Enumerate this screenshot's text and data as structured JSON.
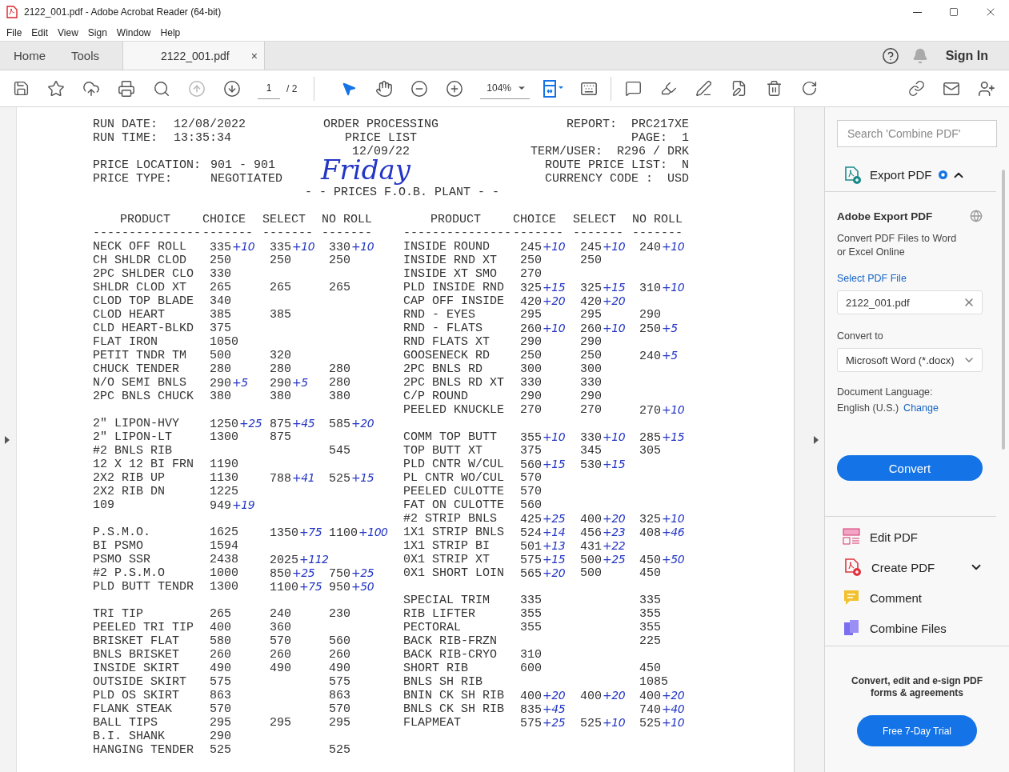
{
  "window": {
    "title": "2122_001.pdf - Adobe Acrobat Reader (64-bit)"
  },
  "menu": [
    "File",
    "Edit",
    "View",
    "Sign",
    "Window",
    "Help"
  ],
  "tabs": [
    {
      "kind": "nav",
      "label": "Home",
      "selected": false
    },
    {
      "kind": "nav",
      "label": "Tools",
      "selected": false
    },
    {
      "kind": "document",
      "label": "2122_001.pdf",
      "close": "×",
      "selected": true
    }
  ],
  "sign_in": "Sign In",
  "toolbar": {
    "previous_page": {
      "disabled": true
    },
    "next_page": {
      "disabled": false
    },
    "page": "1",
    "page_total": "/ 2",
    "tools": [
      {
        "selected": true
      },
      {
        "selected": false
      }
    ],
    "zoom": "104%"
  },
  "document": {
    "header_left": [
      [
        {
          "label": "RUN DATE:",
          "value": "12/08/2022"
        },
        {
          "label": "RUN TIME:",
          "value": "13:35:34"
        }
      ],
      [
        {
          "label": "PRICE LOCATION:",
          "value": "901 - 901"
        },
        {
          "label": "PRICE TYPE:",
          "value": "NEGOTIATED"
        }
      ]
    ],
    "header_center": [
      "ORDER PROCESSING",
      "PRICE LIST",
      "12/09/22"
    ],
    "handwriting": "Friday",
    "subtitle": "- - PRICES F.O.B. PLANT - -",
    "header_right": [
      {
        "label": "REPORT:",
        "value": "PRC217XE"
      },
      {
        "label": "PAGE:",
        "value": "1"
      },
      {
        "label": "TERM/USER:",
        "value": "R296 / DRK"
      },
      {
        "label": "ROUTE PRICE LIST:",
        "value": "N"
      },
      {
        "label": "CURRENCY CODE :",
        "value": "USD"
      }
    ],
    "tables": [
      {
        "columns": [
          "PRODUCT",
          "CHOICE",
          "SELECT",
          "NO ROLL"
        ],
        "rules": [
          "---------------",
          "-------",
          "-------",
          "-------"
        ],
        "groups": [
          [
            {
              "product": "NECK OFF ROLL",
              "choice": {
                "price": "335",
                "note": "+10"
              },
              "select": {
                "price": "335",
                "note": "+10"
              },
              "no_roll": {
                "price": "330",
                "note": "+10"
              }
            },
            {
              "product": "CH SHLDR CLOD",
              "choice": {
                "price": "250"
              },
              "select": {
                "price": "250"
              },
              "no_roll": {
                "price": "250"
              }
            },
            {
              "product": "2PC SHLDER CLO",
              "choice": {
                "price": "330"
              }
            },
            {
              "product": "SHLDR CLOD XT",
              "choice": {
                "price": "265"
              },
              "select": {
                "price": "265"
              },
              "no_roll": {
                "price": "265"
              }
            },
            {
              "product": "CLOD TOP BLADE",
              "choice": {
                "price": "340"
              }
            },
            {
              "product": "CLOD HEART",
              "choice": {
                "price": "385"
              },
              "select": {
                "price": "385"
              }
            },
            {
              "product": "CLD HEART-BLKD",
              "choice": {
                "price": "375"
              }
            },
            {
              "product": "FLAT IRON",
              "choice": {
                "price": "1050"
              }
            },
            {
              "product": "PETIT TNDR TM",
              "choice": {
                "price": "500"
              },
              "select": {
                "price": "320"
              }
            },
            {
              "product": "CHUCK TENDER",
              "choice": {
                "price": "280"
              },
              "select": {
                "price": "280"
              },
              "no_roll": {
                "price": "280"
              }
            },
            {
              "product": "N/O SEMI BNLS",
              "choice": {
                "price": "290",
                "note": "+5"
              },
              "select": {
                "price": "290",
                "note": "+5"
              },
              "no_roll": {
                "price": "280"
              }
            },
            {
              "product": "2PC BNLS CHUCK",
              "choice": {
                "price": "380"
              },
              "select": {
                "price": "380"
              },
              "no_roll": {
                "price": "380"
              }
            }
          ],
          [
            {
              "product": "2\" LIPON-HVY",
              "choice": {
                "price": "1250",
                "note": "+25"
              },
              "select": {
                "price": "875",
                "note": "+45"
              },
              "no_roll": {
                "price": "585",
                "note": "+20"
              }
            },
            {
              "product": "2\" LIPON-LT",
              "choice": {
                "price": "1300"
              },
              "select": {
                "price": "875"
              }
            },
            {
              "product": "#2 BNLS RIB",
              "no_roll": {
                "price": "545"
              }
            },
            {
              "product": "12 X 12 BI FRN",
              "choice": {
                "price": "1190"
              }
            },
            {
              "product": "2X2 RIB UP",
              "choice": {
                "price": "1130"
              },
              "select": {
                "price": "788",
                "note": "+41"
              },
              "no_roll": {
                "price": "525",
                "note": "+15"
              }
            },
            {
              "product": "2X2 RIB DN",
              "choice": {
                "price": "1225"
              }
            },
            {
              "product": "109",
              "choice": {
                "price": "949",
                "note": "+19"
              }
            }
          ],
          [
            {
              "product": "P.S.M.O.",
              "choice": {
                "price": "1625"
              },
              "select": {
                "price": "1350",
                "note": "+75"
              },
              "no_roll": {
                "price": "1100",
                "note": "+100"
              }
            },
            {
              "product": "BI PSMO",
              "choice": {
                "price": "1594"
              }
            },
            {
              "product": "PSMO SSR",
              "choice": {
                "price": "2438"
              },
              "select": {
                "price": "2025",
                "note": "+112"
              }
            },
            {
              "product": "#2 P.S.M.O",
              "choice": {
                "price": "1000"
              },
              "select": {
                "price": "850",
                "note": "+25"
              },
              "no_roll": {
                "price": "750",
                "note": "+25"
              }
            },
            {
              "product": "PLD BUTT TENDR",
              "choice": {
                "price": "1300"
              },
              "select": {
                "price": "1100",
                "note": "+75"
              },
              "no_roll": {
                "price": "950",
                "note": "+50"
              }
            }
          ],
          [
            {
              "product": "TRI TIP",
              "choice": {
                "price": "265"
              },
              "select": {
                "price": "240"
              },
              "no_roll": {
                "price": "230"
              }
            },
            {
              "product": "PEELED TRI TIP",
              "choice": {
                "price": "400"
              },
              "select": {
                "price": "360"
              }
            },
            {
              "product": "BRISKET FLAT",
              "choice": {
                "price": "580"
              },
              "select": {
                "price": "570"
              },
              "no_roll": {
                "price": "560"
              }
            },
            {
              "product": "BNLS BRISKET",
              "choice": {
                "price": "260"
              },
              "select": {
                "price": "260"
              },
              "no_roll": {
                "price": "260"
              }
            },
            {
              "product": "INSIDE SKIRT",
              "choice": {
                "price": "490"
              },
              "select": {
                "price": "490"
              },
              "no_roll": {
                "price": "490"
              }
            },
            {
              "product": "OUTSIDE SKIRT",
              "choice": {
                "price": "575"
              },
              "no_roll": {
                "price": "575"
              }
            },
            {
              "product": "PLD OS SKIRT",
              "choice": {
                "price": "863"
              },
              "no_roll": {
                "price": "863"
              }
            },
            {
              "product": "FLANK STEAK",
              "choice": {
                "price": "570"
              },
              "no_roll": {
                "price": "570"
              }
            },
            {
              "product": "BALL TIPS",
              "choice": {
                "price": "295"
              },
              "select": {
                "price": "295"
              },
              "no_roll": {
                "price": "295"
              }
            },
            {
              "product": "B.I. SHANK",
              "choice": {
                "price": "290"
              }
            },
            {
              "product": "HANGING TENDER",
              "choice": {
                "price": "525"
              },
              "no_roll": {
                "price": "525"
              }
            }
          ]
        ]
      },
      {
        "columns": [
          "PRODUCT",
          "CHOICE",
          "SELECT",
          "NO ROLL"
        ],
        "rules": [
          "---------------",
          "-------",
          "-------",
          "-------"
        ],
        "groups": [
          [
            {
              "product": "INSIDE ROUND",
              "choice": {
                "price": "245",
                "note": "+10"
              },
              "select": {
                "price": "245",
                "note": "+10"
              },
              "no_roll": {
                "price": "240",
                "note": "+10"
              }
            },
            {
              "product": "INSIDE RND XT",
              "choice": {
                "price": "250"
              },
              "select": {
                "price": "250"
              }
            },
            {
              "product": "INSIDE XT SMO",
              "choice": {
                "price": "270"
              }
            },
            {
              "product": "PLD INSIDE RND",
              "choice": {
                "price": "325",
                "note": "+15"
              },
              "select": {
                "price": "325",
                "note": "+15"
              },
              "no_roll": {
                "price": "310",
                "note": "+10"
              }
            },
            {
              "product": "CAP OFF INSIDE",
              "choice": {
                "price": "420",
                "note": "+20"
              },
              "select": {
                "price": "420",
                "note": "+20"
              }
            },
            {
              "product": "RND - EYES",
              "choice": {
                "price": "295"
              },
              "select": {
                "price": "295"
              },
              "no_roll": {
                "price": "290"
              }
            },
            {
              "product": "RND - FLATS",
              "choice": {
                "price": "260",
                "note": "+10"
              },
              "select": {
                "price": "260",
                "note": "+10"
              },
              "no_roll": {
                "price": "250",
                "note": "+5"
              }
            },
            {
              "product": "RND FLATS XT",
              "choice": {
                "price": "290"
              },
              "select": {
                "price": "290"
              }
            },
            {
              "product": "GOOSENECK RD",
              "choice": {
                "price": "250"
              },
              "select": {
                "price": "250"
              },
              "no_roll": {
                "price": "240",
                "note": "+5"
              }
            },
            {
              "product": "2PC BNLS RD",
              "choice": {
                "price": "300"
              },
              "select": {
                "price": "300"
              }
            },
            {
              "product": "2PC BNLS RD XT",
              "choice": {
                "price": "330"
              },
              "select": {
                "price": "330"
              }
            },
            {
              "product": "C/P ROUND",
              "choice": {
                "price": "290"
              },
              "select": {
                "price": "290"
              }
            },
            {
              "product": "PEELED KNUCKLE",
              "choice": {
                "price": "270"
              },
              "select": {
                "price": "270"
              },
              "no_roll": {
                "price": "270",
                "note": "+10"
              }
            }
          ],
          [
            {
              "product": "COMM TOP BUTT",
              "choice": {
                "price": "355",
                "note": "+10"
              },
              "select": {
                "price": "330",
                "note": "+10"
              },
              "no_roll": {
                "price": "285",
                "note": "+15"
              }
            },
            {
              "product": "TOP BUTT XT",
              "choice": {
                "price": "375"
              },
              "select": {
                "price": "345"
              },
              "no_roll": {
                "price": "305"
              }
            },
            {
              "product": "PLD CNTR W/CUL",
              "choice": {
                "price": "560",
                "note": "+15"
              },
              "select": {
                "price": "530",
                "note": "+15"
              }
            },
            {
              "product": "PL CNTR WO/CUL",
              "choice": {
                "price": "570"
              }
            },
            {
              "product": "PEELED CULOTTE",
              "choice": {
                "price": "570"
              }
            },
            {
              "product": "FAT ON CULOTTE",
              "choice": {
                "price": "560"
              }
            },
            {
              "product": "#2 STRIP BNLS",
              "choice": {
                "price": "425",
                "note": "+25"
              },
              "select": {
                "price": "400",
                "note": "+20"
              },
              "no_roll": {
                "price": "325",
                "note": "+10"
              }
            },
            {
              "product": "1X1 STRIP BNLS",
              "choice": {
                "price": "524",
                "note": "+14"
              },
              "select": {
                "price": "456",
                "note": "+23"
              },
              "no_roll": {
                "price": "408",
                "note": "+46"
              }
            },
            {
              "product": "1X1 STRIP BI",
              "choice": {
                "price": "501",
                "note": "+13"
              },
              "select": {
                "price": "431",
                "note": "+22"
              }
            },
            {
              "product": "0X1 STRIP XT",
              "choice": {
                "price": "575",
                "note": "+15"
              },
              "select": {
                "price": "500",
                "note": "+25"
              },
              "no_roll": {
                "price": "450",
                "note": "+50"
              }
            },
            {
              "product": "0X1 SHORT LOIN",
              "choice": {
                "price": "565",
                "note": "+20"
              },
              "select": {
                "price": "500"
              },
              "no_roll": {
                "price": "450"
              }
            }
          ],
          [
            {
              "product": "SPECIAL TRIM",
              "choice": {
                "price": "335"
              },
              "no_roll": {
                "price": "335"
              }
            },
            {
              "product": "RIB LIFTER",
              "choice": {
                "price": "355"
              },
              "no_roll": {
                "price": "355"
              }
            },
            {
              "product": "PECTORAL",
              "choice": {
                "price": "355"
              },
              "no_roll": {
                "price": "355"
              }
            },
            {
              "product": "BACK RIB-FRZN",
              "no_roll": {
                "price": "225"
              }
            },
            {
              "product": "BACK RIB-CRYO",
              "choice": {
                "price": "310"
              }
            },
            {
              "product": "SHORT RIB",
              "choice": {
                "price": "600"
              },
              "no_roll": {
                "price": "450"
              }
            },
            {
              "product": "BNLS SH RIB",
              "no_roll": {
                "price": "1085"
              }
            },
            {
              "product": "BNIN CK SH RIB",
              "choice": {
                "price": "400",
                "note": "+20"
              },
              "select": {
                "price": "400",
                "note": "+20"
              },
              "no_roll": {
                "price": "400",
                "note": "+20"
              }
            },
            {
              "product": "BNLS CK SH RIB",
              "choice": {
                "price": "835",
                "note": "+45"
              },
              "no_roll": {
                "price": "740",
                "note": "+40"
              }
            },
            {
              "product": "FLAPMEAT",
              "choice": {
                "price": "575",
                "note": "+25"
              },
              "select": {
                "price": "525",
                "note": "+10"
              },
              "no_roll": {
                "price": "525",
                "note": "+10"
              }
            }
          ]
        ]
      }
    ]
  },
  "panel": {
    "search": {
      "placeholder": "Search 'Combine PDF'"
    },
    "export": {
      "title": "Export PDF",
      "expanded": true,
      "heading": "Adobe Export PDF",
      "description": "Convert PDF Files to Word or Excel Online",
      "select_label": "Select PDF File",
      "file": "2122_001.pdf",
      "convert_label": "Convert to",
      "format": "Microsoft Word (*.docx)",
      "language_label": "Document Language:",
      "language": "English (U.S.)",
      "change": "Change",
      "button": "Convert"
    },
    "tools": [
      {
        "kind": "edit",
        "label": "Edit PDF",
        "expandable": false
      },
      {
        "kind": "create",
        "label": "Create PDF",
        "expandable": true
      },
      {
        "kind": "comment",
        "label": "Comment",
        "expandable": false
      },
      {
        "kind": "combine",
        "label": "Combine Files",
        "expandable": false
      }
    ],
    "promo": {
      "text": "Convert, edit and e-sign PDF forms & agreements",
      "button": "Free 7-Day Trial"
    }
  }
}
